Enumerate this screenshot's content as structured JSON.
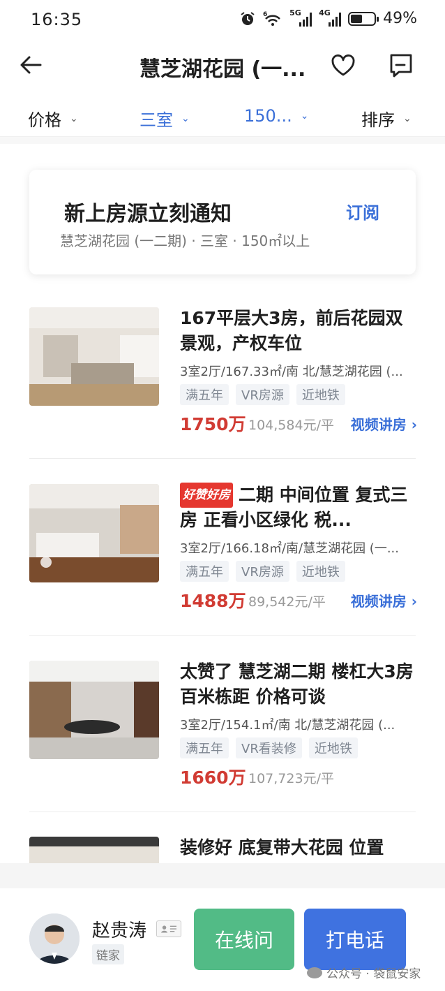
{
  "status_bar": {
    "time": "16:35",
    "network_1": "5G",
    "network_2": "4G",
    "signal_small": "6",
    "battery_percent": "49%",
    "battery_level": 0.49,
    "icons": [
      "alarm-icon",
      "wifi-icon",
      "signal-5g-icon",
      "signal-4g-icon",
      "battery-icon"
    ]
  },
  "nav": {
    "title": "慧芝湖花园 (一...",
    "icons": [
      "back-arrow-icon",
      "heart-icon",
      "message-icon"
    ]
  },
  "filters": [
    {
      "label": "价格",
      "active": false
    },
    {
      "label": "三室",
      "active": true
    },
    {
      "label": "150...",
      "active": true
    },
    {
      "label": "排序",
      "active": false
    }
  ],
  "subscribe": {
    "title": "新上房源立刻通知",
    "action": "订阅",
    "description": "慧芝湖花园 (一二期) · 三室 · 150㎡以上"
  },
  "listings": [
    {
      "title": "167平层大3房，前后花园双景观，产权车位",
      "badge": "",
      "meta": "3室2厅/167.33㎡/南 北/慧芝湖花园 (...",
      "tags": [
        "满五年",
        "VR房源",
        "近地铁"
      ],
      "price": "1750万",
      "unit_price": "104,584元/平",
      "video": "视频讲房 ›"
    },
    {
      "title": "二期 中间位置 复式三房 正看小区绿化 税...",
      "badge": "好赞好房",
      "meta": "3室2厅/166.18㎡/南/慧芝湖花园 (一...",
      "tags": [
        "满五年",
        "VR房源",
        "近地铁"
      ],
      "price": "1488万",
      "unit_price": "89,542元/平",
      "video": "视频讲房 ›"
    },
    {
      "title": "太赞了 慧芝湖二期 楼杠大3房 百米栋距 价格可谈",
      "badge": "",
      "meta": "3室2厅/154.1㎡/南 北/慧芝湖花园 (...",
      "tags": [
        "满五年",
        "VR看装修",
        "近地铁"
      ],
      "price": "1660万",
      "unit_price": "107,723元/平",
      "video": ""
    },
    {
      "title": "装修好 底复带大花园 位置",
      "badge": "",
      "meta": "",
      "tags": [],
      "price": "",
      "unit_price": "",
      "video": ""
    }
  ],
  "agent": {
    "name": "赵贵涛",
    "agency": "链家",
    "chat_label": "在线问",
    "call_label": "打电话"
  },
  "watermark": "公众号 · 袋鼠安家",
  "colors": {
    "accent_blue": "#3a6fd8",
    "price_red": "#d13b33",
    "chat_green": "#52bb86",
    "call_blue": "#3f72e0"
  }
}
